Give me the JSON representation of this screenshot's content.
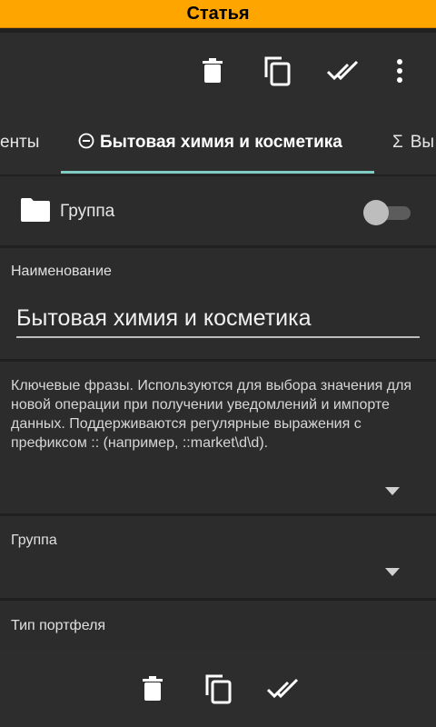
{
  "app": {
    "title": "Статья"
  },
  "toolbar": {
    "icons": [
      "delete-icon",
      "copy-icon",
      "done-all-icon",
      "more-vert-icon"
    ]
  },
  "tabs": [
    {
      "label": "енты"
    },
    {
      "label": "Бытовая химия и косметика",
      "icon": "minus-circle-icon",
      "active": true
    },
    {
      "label": "Вы",
      "icon": "sigma-icon"
    }
  ],
  "group_toggle": {
    "label": "Группа",
    "on": false
  },
  "name_field": {
    "label": "Наименование",
    "value": "Бытовая химия и косметика"
  },
  "keywords_field": {
    "hint": "Ключевые фразы. Используются для выбора значения для новой операции при получении уведомлений и импорте данных. Поддерживаются регулярные выражения с префиксом :: (например, ::market\\d\\d)."
  },
  "group_select": {
    "label": "Группа",
    "value": ""
  },
  "portfolio_select": {
    "label": "Тип портфеля"
  },
  "bottom_bar": {
    "icons": [
      "delete-icon",
      "copy-icon",
      "done-all-icon"
    ]
  },
  "colors": {
    "accent": "#ffa500",
    "tab_indicator": "#80cbc4",
    "background": "#202020",
    "surface": "#2c2c2c"
  }
}
